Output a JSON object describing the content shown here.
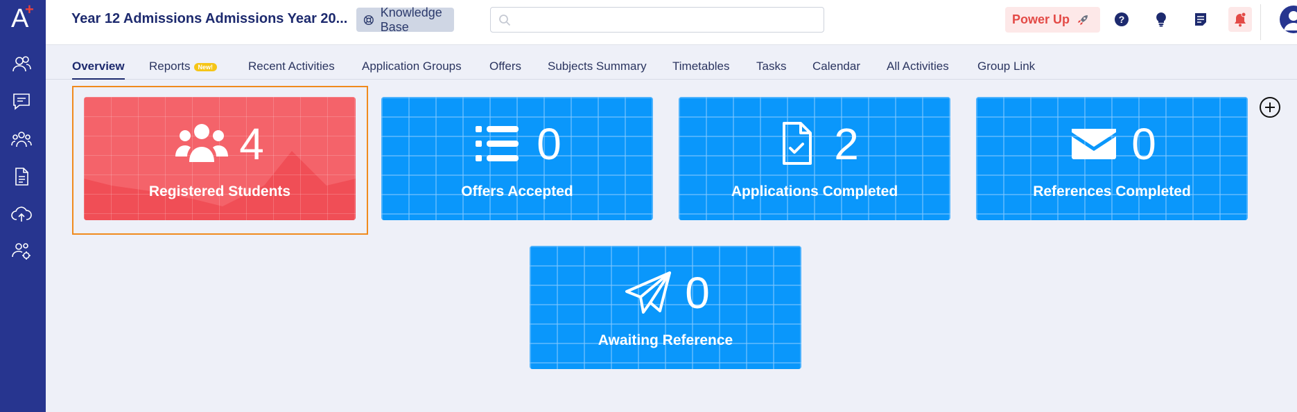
{
  "app": {
    "logo_letter": "A",
    "logo_plus": "+"
  },
  "header": {
    "title": "Year 12 Admissions Admissions Year 20...",
    "knowledge_base": "Knowledge Base",
    "search_placeholder": "",
    "power_up": "Power Up"
  },
  "tabs": [
    {
      "label": "Overview",
      "active": true
    },
    {
      "label": "Reports",
      "badge": "New!"
    },
    {
      "label": "Recent Activities"
    },
    {
      "label": "Application Groups"
    },
    {
      "label": "Offers"
    },
    {
      "label": "Subjects Summary"
    },
    {
      "label": "Timetables"
    },
    {
      "label": "Tasks"
    },
    {
      "label": "Calendar"
    },
    {
      "label": "All Activities"
    },
    {
      "label": "Group Link"
    }
  ],
  "cards": [
    {
      "count": "4",
      "label": "Registered Students",
      "icon": "users-icon",
      "color": "#f4636a"
    },
    {
      "count": "0",
      "label": "Offers Accepted",
      "icon": "list-icon",
      "color": "#0a97fb"
    },
    {
      "count": "2",
      "label": "Applications Completed",
      "icon": "file-check-icon",
      "color": "#0a97fb"
    },
    {
      "count": "0",
      "label": "References Completed",
      "icon": "envelope-icon",
      "color": "#0a97fb"
    },
    {
      "count": "0",
      "label": "Awaiting Reference",
      "icon": "paper-plane-icon",
      "color": "#0a97fb"
    }
  ],
  "colors": {
    "sidebar": "#27358f",
    "accent": "#1d2a6e",
    "selected_outline": "#f08a1d"
  }
}
